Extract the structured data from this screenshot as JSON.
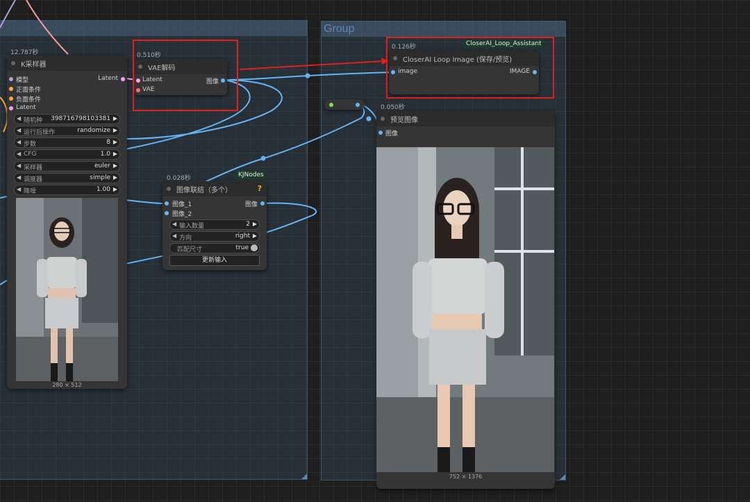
{
  "group": {
    "title": "Group"
  },
  "ksampler": {
    "timing": "12.787秒",
    "title": "K采样器",
    "inputs": [
      "模型",
      "正面条件",
      "负面条件",
      "Latent"
    ],
    "output": "Latent",
    "widgets": [
      {
        "label": "随机种",
        "value": "398716798103381"
      },
      {
        "label": "运行后操作",
        "value": "randomize"
      },
      {
        "label": "步数",
        "value": "8"
      },
      {
        "label": "CFG",
        "value": "1.0"
      },
      {
        "label": "采样器",
        "value": "euler"
      },
      {
        "label": "调度器",
        "value": "simple"
      },
      {
        "label": "降噪",
        "value": "1.00"
      }
    ],
    "image_size": "280 × 512"
  },
  "vae": {
    "timing": "0.510秒",
    "title": "VAE解码",
    "inputs": [
      "Latent",
      "VAE"
    ],
    "output": "图像"
  },
  "concat": {
    "timing": "0.028秒",
    "badge": "KJNodes",
    "help": "?",
    "title": "图像联结（多个）",
    "inputs": [
      "图像_1",
      "图像_2"
    ],
    "output": "图像",
    "widgets": [
      {
        "label": "输入数量",
        "value": "2"
      },
      {
        "label": "方向",
        "value": "right"
      },
      {
        "label": "匹配尺寸",
        "value": "true"
      }
    ],
    "button": "更新输入"
  },
  "loop": {
    "timing": "0.126秒",
    "badge": "CloserAI_Loop_Assistant",
    "title": "CloserAI Loop Image (保存/预览)",
    "input": "image",
    "output": "IMAGE"
  },
  "preview": {
    "timing": "0.050秒",
    "title": "预览图像",
    "input": "图像",
    "image_size": "752 × 1376"
  },
  "colors": {
    "latent": "#ff9cf9",
    "vae": "#ff6e6e",
    "image": "#64b5f6",
    "model": "#b39ddb",
    "conditioning": "#ffa931",
    "highlight": "#e0201c"
  }
}
